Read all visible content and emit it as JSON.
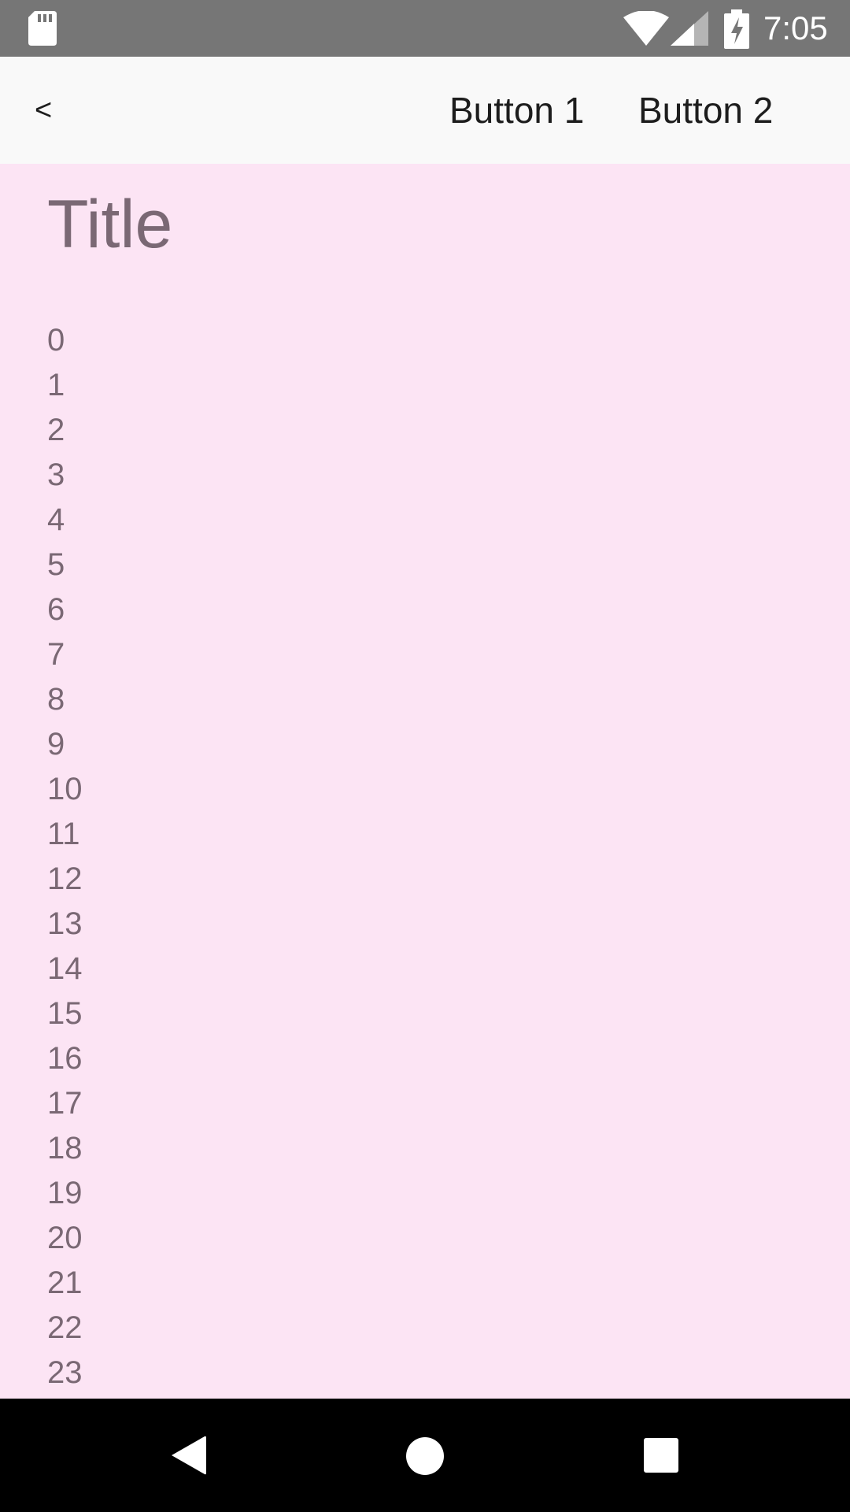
{
  "status_bar": {
    "time": "7:05",
    "icons": [
      "sd-card-icon",
      "wifi-icon",
      "signal-icon",
      "battery-charging-icon"
    ]
  },
  "app_bar": {
    "back_label": "<",
    "button1_label": "Button 1",
    "button2_label": "Button 2"
  },
  "content": {
    "title": "Title",
    "items": [
      "0",
      "1",
      "2",
      "3",
      "4",
      "5",
      "6",
      "7",
      "8",
      "9",
      "10",
      "11",
      "12",
      "13",
      "14",
      "15",
      "16",
      "17",
      "18",
      "19",
      "20",
      "21",
      "22",
      "23"
    ]
  },
  "nav_bar": {
    "icons": [
      "nav-back-icon",
      "nav-home-icon",
      "nav-recents-icon"
    ]
  },
  "colors": {
    "status_bar_bg": "#767676",
    "app_bar_bg": "#f9f9f9",
    "content_bg": "#fce4f4",
    "content_text": "#7a6874",
    "nav_bar_bg": "#000000"
  }
}
